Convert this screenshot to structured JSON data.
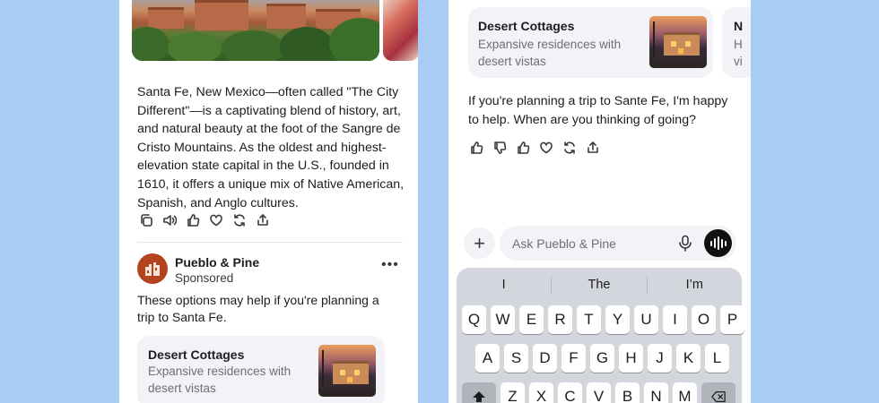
{
  "left_phone": {
    "description_text": "Santa Fe, New Mexico—often called \"The City Different\"—is a captivating blend of history, art, and natural beauty at the foot of the Sangre de Cristo Mountains. As the oldest and highest-elevation state capital in the U.S., founded in 1610, it offers a unique mix of Native American, Spanish, and Anglo cultures.",
    "actions": [
      "copy-icon",
      "speaker-icon",
      "thumbs-up-icon",
      "heart-icon",
      "regenerate-icon",
      "share-icon"
    ],
    "sponsor": {
      "name": "Pueblo & Pine",
      "tag": "Sponsored",
      "more": "•••",
      "text": "These options may help if you're planning a trip to Santa Fe."
    },
    "card": {
      "title": "Desert Cottages",
      "subtitle": "Expansive residences with desert vistas"
    }
  },
  "right_phone": {
    "card": {
      "title": "Desert Cottages",
      "subtitle": "Expansive residences with desert vistas"
    },
    "peek_card": {
      "title": "N",
      "subtitle_line1": "H",
      "subtitle_line2": "vi"
    },
    "assistant_text": "If you're planning a trip to Sante Fe, I'm happy to help. When are you thinking of going?",
    "actions": [
      "thumbs-up-icon",
      "thumbs-down-icon",
      "thumbs-up-icon",
      "heart-icon",
      "regenerate-icon",
      "share-icon"
    ],
    "composer": {
      "plus_label": "+",
      "placeholder": "Ask Pueblo & Pine"
    },
    "keyboard": {
      "suggestions": [
        "I",
        "The",
        "I’m"
      ],
      "row1": [
        "Q",
        "W",
        "E",
        "R",
        "T",
        "Y",
        "U",
        "I",
        "O",
        "P"
      ],
      "row2": [
        "A",
        "S",
        "D",
        "F",
        "G",
        "H",
        "J",
        "K",
        "L"
      ],
      "row3": [
        "Z",
        "X",
        "C",
        "V",
        "B",
        "N",
        "M"
      ]
    }
  }
}
